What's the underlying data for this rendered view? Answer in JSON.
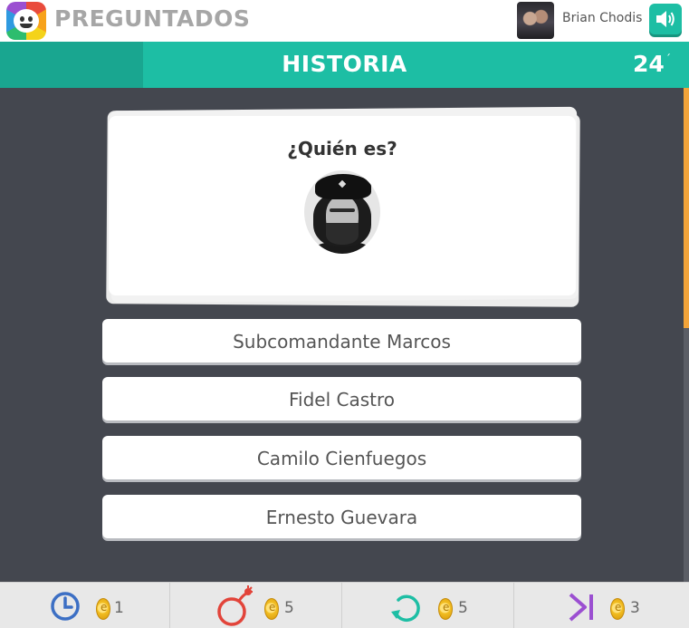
{
  "header": {
    "app_title": "PREGUNTADOS",
    "logo_icon": "preguntados-logo-icon",
    "user_name": "Brian Chodis",
    "sound_icon": "speaker-icon"
  },
  "category_bar": {
    "category": "HISTORIA",
    "timer": "24",
    "timer_mark": "´",
    "color": "#1dbea4"
  },
  "question": {
    "text": "¿Quién es?",
    "image_icon": "portrait-photo"
  },
  "answers": [
    {
      "label": "Subcomandante Marcos"
    },
    {
      "label": "Fidel Castro"
    },
    {
      "label": "Camilo Cienfuegos"
    },
    {
      "label": "Ernesto Guevara"
    }
  ],
  "powerups": [
    {
      "icon": "clock-icon",
      "cost": "1",
      "color": "#3c6fc4"
    },
    {
      "icon": "bomb-icon",
      "cost": "5",
      "color": "#e2443a"
    },
    {
      "icon": "refresh-icon",
      "cost": "5",
      "color": "#1dbea4"
    },
    {
      "icon": "skip-icon",
      "cost": "3",
      "color": "#9b4fd1"
    }
  ],
  "progress_level": 0.49
}
